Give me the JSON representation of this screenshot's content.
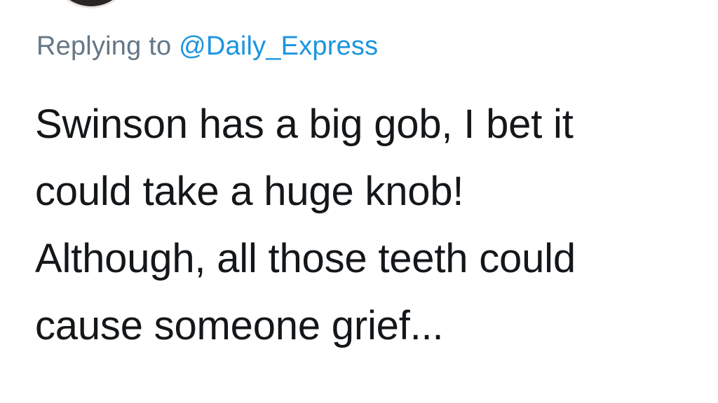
{
  "reply": {
    "prefix": "Replying to",
    "handle": "@Daily_Express"
  },
  "tweet": {
    "lines": [
      "Swinson has a big gob, I bet it",
      "could take a huge knob!",
      "Although, all those teeth could",
      "cause someone grief..."
    ]
  },
  "colors": {
    "reply_text": "#657786",
    "link": "#1b95e0",
    "body_text": "#14171a",
    "background": "#ffffff"
  }
}
